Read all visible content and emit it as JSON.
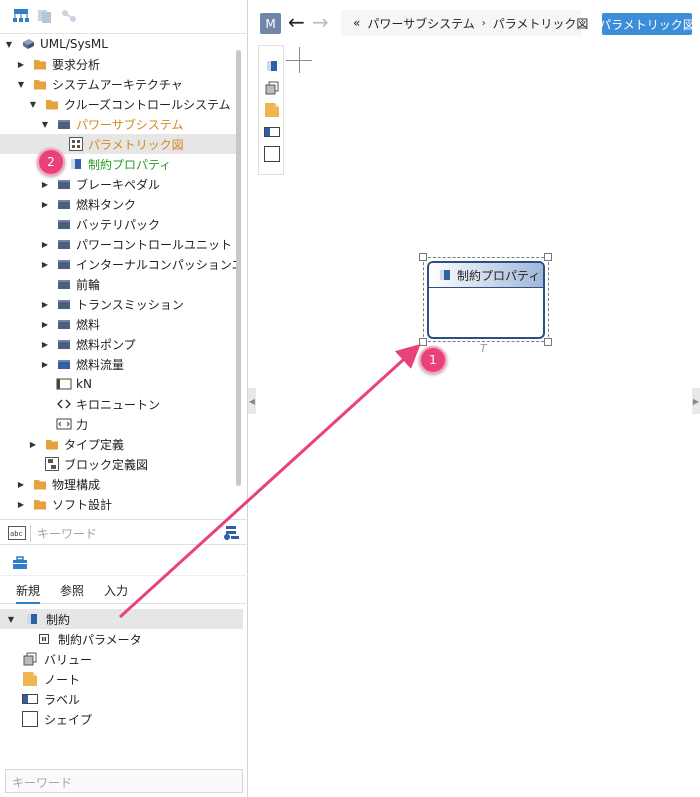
{
  "tree": {
    "root": "UML/SysML",
    "items": [
      {
        "label": "要求分析"
      },
      {
        "label": "システムアーキテクチャ"
      },
      {
        "label": "クルーズコントロールシステム"
      },
      {
        "label": "パワーサブシステム"
      },
      {
        "label": "パラメトリック図"
      },
      {
        "label": "制約プロパティ"
      },
      {
        "label": "ブレーキペダル"
      },
      {
        "label": "燃料タンク"
      },
      {
        "label": "バッテリパック"
      },
      {
        "label": "パワーコントロールユニット"
      },
      {
        "label": "インターナルコンパッションエンジン"
      },
      {
        "label": "前輪"
      },
      {
        "label": "トランスミッション"
      },
      {
        "label": "燃料"
      },
      {
        "label": "燃料ポンプ"
      },
      {
        "label": "燃料流量"
      },
      {
        "label": "kN"
      },
      {
        "label": "キロニュートン"
      },
      {
        "label": "力"
      },
      {
        "label": "タイプ定義"
      },
      {
        "label": "ブロック定義図"
      },
      {
        "label": "物理構成"
      },
      {
        "label": "ソフト設計"
      }
    ]
  },
  "search": {
    "placeholder_top": "キーワード",
    "placeholder_bottom": "キーワード"
  },
  "palette": {
    "tabs": [
      "新規",
      "参照",
      "入力"
    ],
    "items": [
      {
        "label": "制約"
      },
      {
        "label": "制約パラメータ"
      },
      {
        "label": "バリュー"
      },
      {
        "label": "ノート"
      },
      {
        "label": "ラベル"
      },
      {
        "label": "シェイプ"
      }
    ]
  },
  "editor": {
    "m_label": "M",
    "breadcrumb": [
      "«",
      "パワーサブシステム",
      "›",
      "パラメトリック図"
    ],
    "diagram_button": "パラメトリック図",
    "block_label": "制約プロパティ",
    "t_mark": "T"
  },
  "callouts": {
    "one": "1",
    "two": "2"
  },
  "colors": {
    "accent": "#3d8ed9",
    "badge": "#e9427a",
    "orange_text": "#d4881d",
    "green_text": "#2b9a2b",
    "block_border": "#2d4f84"
  }
}
